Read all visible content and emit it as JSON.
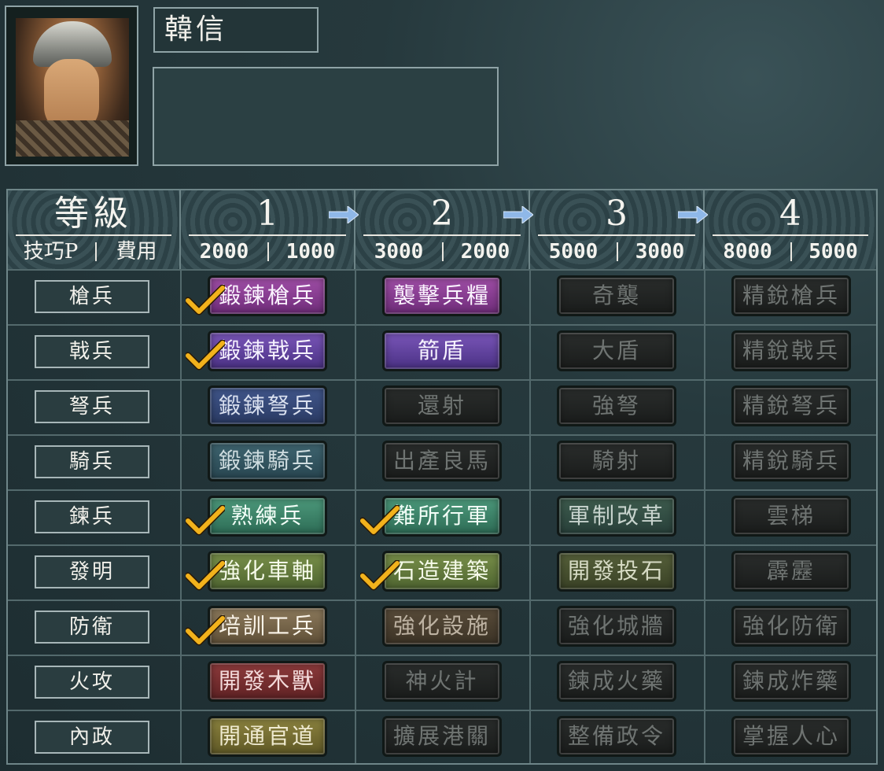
{
  "general": {
    "name": "韓信",
    "description": ""
  },
  "header": {
    "level_label": "等級",
    "points_label": "技巧P",
    "cost_label": "費用",
    "tiers": [
      {
        "level": "1",
        "points": "2000",
        "cost": "1000"
      },
      {
        "level": "2",
        "points": "3000",
        "cost": "2000"
      },
      {
        "level": "3",
        "points": "5000",
        "cost": "3000"
      },
      {
        "level": "4",
        "points": "8000",
        "cost": "5000"
      }
    ]
  },
  "rows": [
    {
      "category": "槍兵",
      "skills": [
        "鍛鍊槍兵",
        "襲擊兵糧",
        "奇襲",
        "精銳槍兵"
      ]
    },
    {
      "category": "戟兵",
      "skills": [
        "鍛鍊戟兵",
        "箭盾",
        "大盾",
        "精銳戟兵"
      ]
    },
    {
      "category": "弩兵",
      "skills": [
        "鍛鍊弩兵",
        "還射",
        "強弩",
        "精銳弩兵"
      ]
    },
    {
      "category": "騎兵",
      "skills": [
        "鍛鍊騎兵",
        "出產良馬",
        "騎射",
        "精銳騎兵"
      ]
    },
    {
      "category": "鍊兵",
      "skills": [
        "熟練兵",
        "難所行軍",
        "軍制改革",
        "雲梯"
      ]
    },
    {
      "category": "發明",
      "skills": [
        "強化車軸",
        "石造建築",
        "開發投石",
        "霹靂"
      ]
    },
    {
      "category": "防衛",
      "skills": [
        "培訓工兵",
        "強化設施",
        "強化城牆",
        "強化防衛"
      ]
    },
    {
      "category": "火攻",
      "skills": [
        "開發木獸",
        "神火計",
        "鍊成火藥",
        "鍊成炸藥"
      ]
    },
    {
      "category": "內政",
      "skills": [
        "開通官道",
        "擴展港關",
        "整備政令",
        "掌握人心"
      ]
    }
  ],
  "colors": {
    "check": "#f2b21c",
    "arrow": "#8fb8e8"
  }
}
